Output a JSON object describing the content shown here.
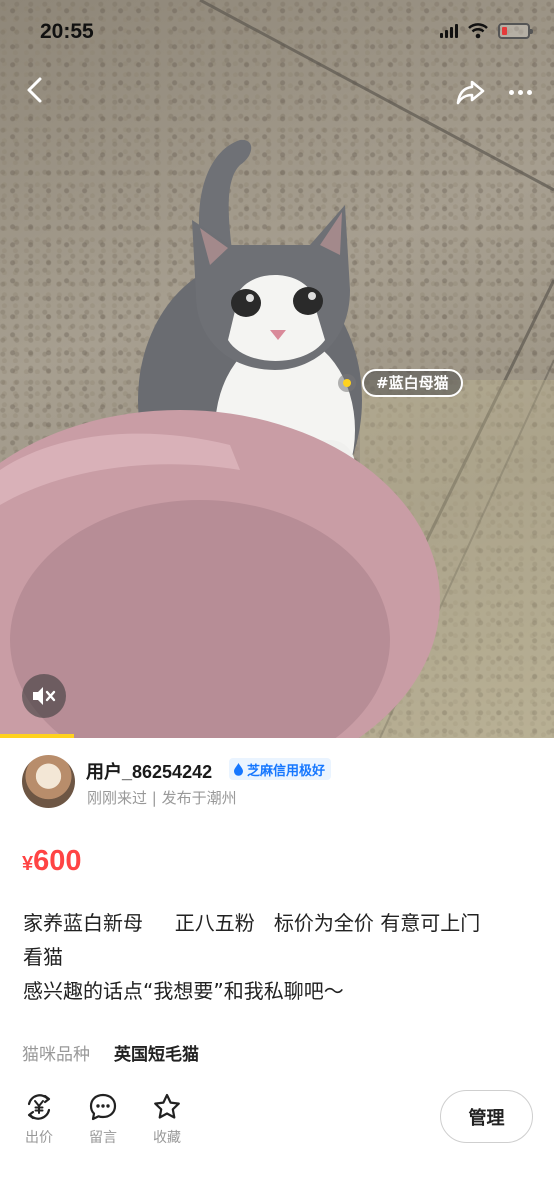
{
  "status_bar": {
    "time": "20:55"
  },
  "media": {
    "tag_text": "#蓝白母猫",
    "icons": {
      "back": "chevron-left-icon",
      "share": "share-arrow-icon",
      "more": "more-dots-icon",
      "mute": "speaker-muted-icon"
    }
  },
  "seller": {
    "name": "用户_86254242",
    "credit_badge": "芝麻信用极好",
    "meta": "刚刚来过 | 发布于潮州"
  },
  "listing": {
    "currency": "¥",
    "price": "600",
    "description_lines": [
      "家养蓝白新母     正八五粉   标价为全价 有意可上门",
      "看猫",
      "感兴趣的话点“我想要”和我私聊吧～"
    ],
    "attribute_label": "猫咪品种",
    "attribute_value": "英国短毛猫"
  },
  "actions": [
    {
      "label": "出价",
      "icon": "yuan-exchange-icon"
    },
    {
      "label": "留言",
      "icon": "message-bubble-icon"
    },
    {
      "label": "收藏",
      "icon": "star-icon"
    }
  ],
  "manage_button": "管理",
  "colors": {
    "price": "#ff4444",
    "accent": "#ffd21e",
    "credit": "#1677ff"
  }
}
